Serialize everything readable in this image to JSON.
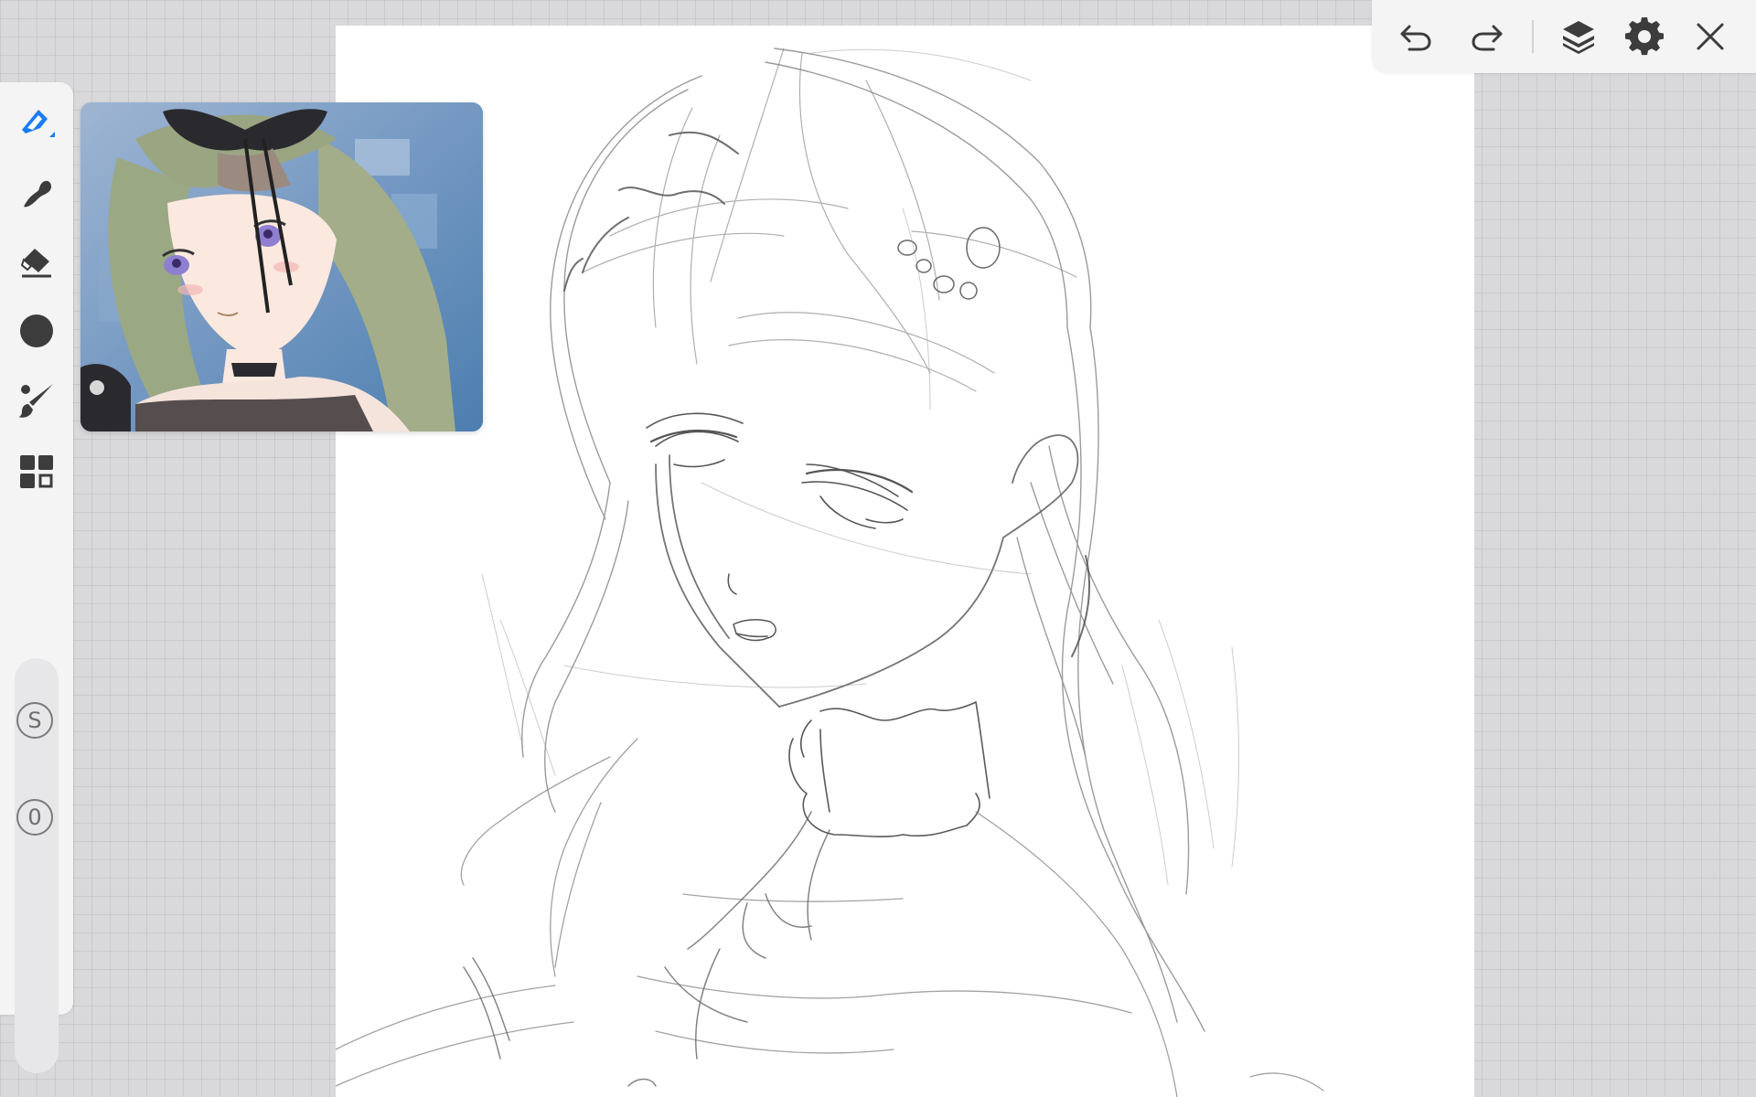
{
  "app": {
    "accent": "#1a7cf5",
    "icon_color": "#3c3c3c"
  },
  "left_toolbar": {
    "tools": [
      {
        "name": "pen",
        "icon": "pen-icon",
        "active": true
      },
      {
        "name": "smudge",
        "icon": "smudge-icon",
        "active": false
      },
      {
        "name": "eraser",
        "icon": "eraser-icon",
        "active": false
      },
      {
        "name": "color",
        "icon": "color-circle-icon",
        "active": false
      },
      {
        "name": "brush",
        "icon": "brush-icon",
        "active": false
      },
      {
        "name": "more",
        "icon": "grid-icon",
        "active": false
      }
    ],
    "size_label": "S",
    "opacity_label": "0"
  },
  "top_toolbar": {
    "buttons": [
      {
        "name": "undo",
        "icon": "undo-icon"
      },
      {
        "name": "redo",
        "icon": "redo-icon"
      },
      {
        "name": "layers",
        "icon": "layers-icon"
      },
      {
        "name": "settings",
        "icon": "gear-icon"
      },
      {
        "name": "close",
        "icon": "close-icon"
      }
    ]
  },
  "reference_image": {
    "icon": "reference-image-icon"
  }
}
